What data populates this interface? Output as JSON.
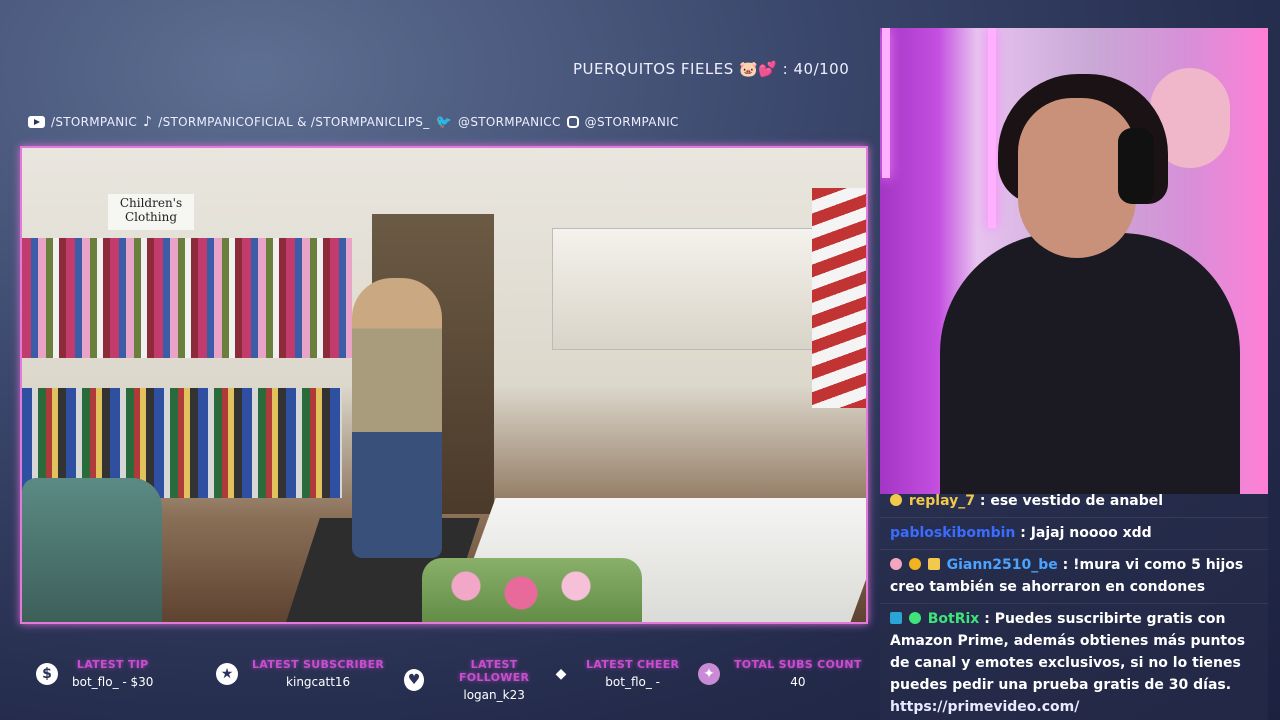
{
  "header": {
    "goal_text": "PUERQUITOS FIELES 🐷💕 : 40/100"
  },
  "socials": [
    {
      "icon": "youtube-icon",
      "text": "/STORMPANIC"
    },
    {
      "icon": "tiktok-icon",
      "text": "/STORMPANICOFICIAL & /STORMPANICLIPS_"
    },
    {
      "icon": "twitter-icon",
      "text": "@STORMPANICC"
    },
    {
      "icon": "instagram-icon",
      "text": "@STORMPANIC"
    }
  ],
  "video": {
    "store_sign": "Children's Clothing"
  },
  "chat": {
    "messages": [
      {
        "user": "replay_7",
        "user_color": "#f2c94c",
        "text": ": ese vestido de anabel"
      },
      {
        "user": "pabloskibombin",
        "user_color": "#3a6cff",
        "text": ": Jajaj noooo xdd"
      },
      {
        "user": "Giann2510_be",
        "user_color": "#4aa3ff",
        "text": ": !mura vi como 5 hijos creo también se ahorraron en condones"
      },
      {
        "user": "BotRix",
        "user_color": "#3ee37a",
        "text": ": Puedes suscribirte gratis con Amazon Prime, además obtienes más puntos de canal y emotes exclusivos, si no lo tienes puedes pedir una prueba gratis de 30 días.",
        "link": "https://primevideo.com/"
      }
    ]
  },
  "stats": [
    {
      "icon": "dollar-icon",
      "glyph": "$",
      "label": "LATEST TIP",
      "value": "bot_flo_ - $30"
    },
    {
      "icon": "star-icon",
      "glyph": "★",
      "label": "LATEST SUBSCRIBER",
      "value": "kingcatt16"
    },
    {
      "icon": "heart-icon",
      "glyph": "♥",
      "label": "LATEST FOLLOWER",
      "value": "logan_k23"
    },
    {
      "icon": "bits-icon",
      "glyph": "◆",
      "label": "LATEST CHEER",
      "value": "bot_flo_ -"
    },
    {
      "icon": "subs-icon",
      "glyph": "✦",
      "label": "TOTAL SUBS COUNT",
      "value": "40"
    }
  ]
}
